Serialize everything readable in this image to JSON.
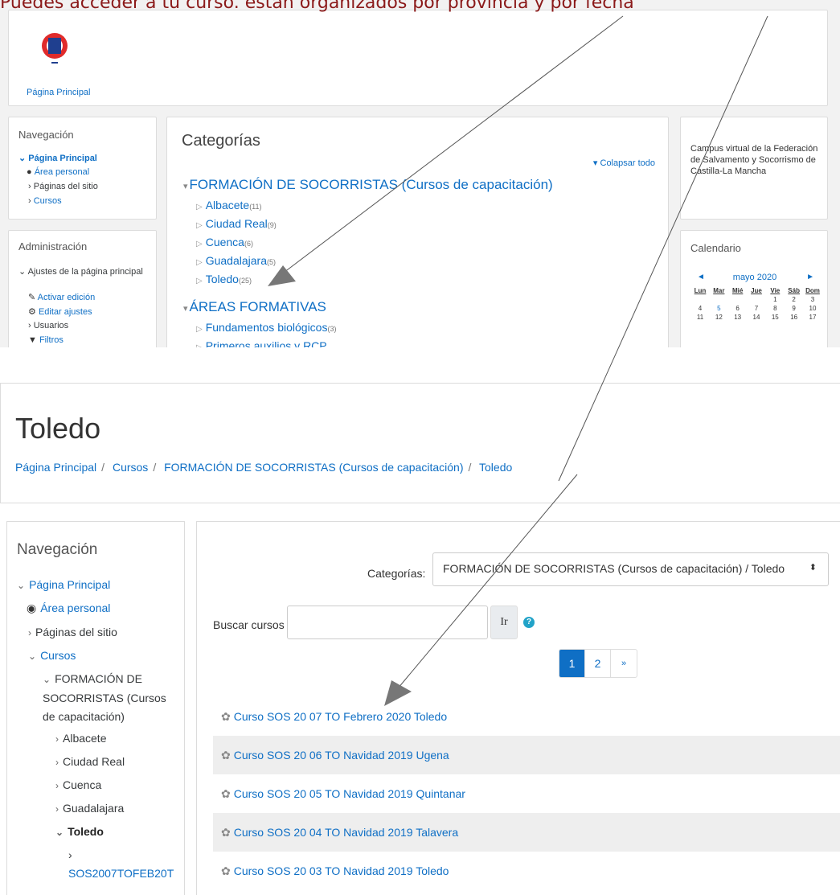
{
  "annotation": {
    "caption": "Puedes acceder a tu curso. están organizados por provincia y por fecha"
  },
  "screen1": {
    "home_link": "Página Principal",
    "nav": {
      "title": "Navegación",
      "items": [
        "Página Principal",
        "Área personal",
        "Páginas del sitio",
        "Cursos"
      ]
    },
    "admin": {
      "title": "Administración",
      "items": [
        "Ajustes de la página principal",
        "Activar edición",
        "Editar ajustes",
        "Usuarios",
        "Filtros"
      ]
    },
    "categories": {
      "title": "Categorías",
      "collapse_label": "Colapsar todo",
      "group1": "FORMACIÓN DE SOCORRISTAS (Cursos de capacitación)",
      "group1_items": [
        {
          "name": "Albacete",
          "count": "(11)"
        },
        {
          "name": "Ciudad Real",
          "count": "(9)"
        },
        {
          "name": "Cuenca",
          "count": "(6)"
        },
        {
          "name": "Guadalajara",
          "count": "(5)"
        },
        {
          "name": "Toledo",
          "count": "(25)"
        }
      ],
      "group2": "ÁREAS FORMATIVAS",
      "group2_items": [
        {
          "name": "Fundamentos biológicos",
          "count": "(3)"
        },
        {
          "name": "Primeros auxilios y RCP",
          "count": ""
        }
      ]
    },
    "info": {
      "text": "Campus virtual de la Federación de Salvamento y Socorrismo de Castilla-La Mancha"
    },
    "calendar": {
      "title": "Calendario",
      "month": "mayo 2020",
      "prev": "◄",
      "next": "►",
      "weekdays": [
        "Lun",
        "Mar",
        "Mié",
        "Jue",
        "Vie",
        "Sáb",
        "Dom"
      ],
      "week1": [
        "",
        "",
        "",
        "",
        "1",
        "2",
        "3"
      ],
      "week2": [
        "4",
        "5",
        "6",
        "7",
        "8",
        "9",
        "10"
      ],
      "week3": [
        "11",
        "12",
        "13",
        "14",
        "15",
        "16",
        "17"
      ]
    }
  },
  "screen2": {
    "title": "Toledo",
    "breadcrumb": [
      "Página Principal",
      "Cursos",
      "FORMACIÓN DE SOCORRISTAS (Cursos de capacitación)",
      "Toledo"
    ],
    "nav": {
      "title": "Navegación",
      "home": "Página Principal",
      "personal": "Área personal",
      "site_pages": "Páginas del sitio",
      "courses": "Cursos",
      "group": "FORMACIÓN DE SOCORRISTAS (Cursos de capacitación)",
      "provinces": [
        "Albacete",
        "Ciudad Real",
        "Cuenca",
        "Guadalajara"
      ],
      "current": "Toledo",
      "sub_course": "SOS2007TOFEB20T"
    },
    "categories_label": "Categorías:",
    "categories_selected": "FORMACIÓN DE SOCORRISTAS (Cursos de capacitación) / Toledo",
    "search_label": "Buscar cursos",
    "search_value": "",
    "go_label": "Ir",
    "help_label": "?",
    "pager": [
      "1",
      "2",
      "»"
    ],
    "courses": [
      "Curso SOS 20 07 TO Febrero 2020 Toledo",
      "Curso SOS 20 06 TO Navidad 2019 Ugena",
      "Curso SOS 20 05 TO Navidad 2019 Quintanar",
      "Curso SOS 20 04 TO Navidad 2019 Talavera",
      "Curso SOS 20 03 TO Navidad 2019 Toledo"
    ]
  }
}
